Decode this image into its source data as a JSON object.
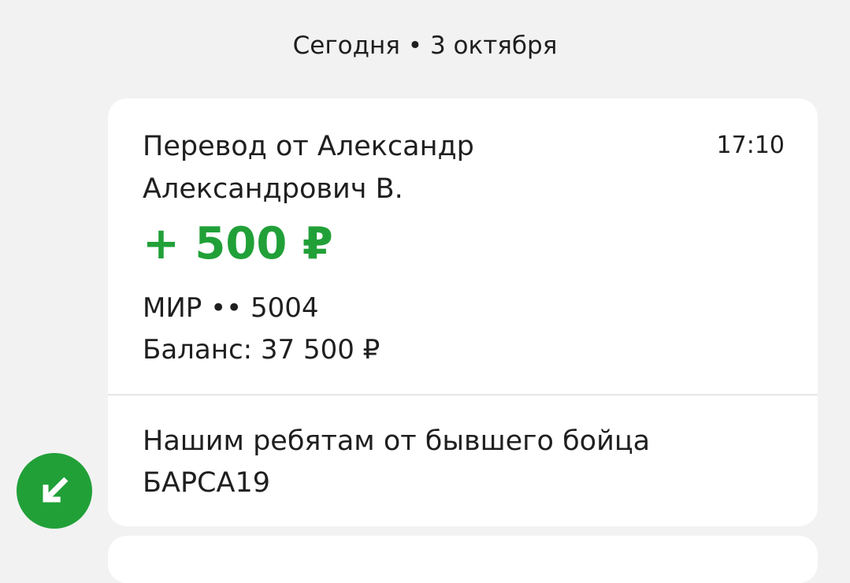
{
  "date_header": "Сегодня • 3 октября",
  "transaction": {
    "title": "Перевод от Александр Александрович В.",
    "time": "17:10",
    "amount": "+ 500 ₽",
    "card": "МИР •• 5004",
    "balance": "Баланс: 37 500 ₽",
    "message": "Нашим ребятам от бывшего бойца БАРСА19"
  },
  "colors": {
    "accent_green": "#21a038",
    "background": "#f2f2f2",
    "card": "#ffffff"
  },
  "icons": {
    "incoming": "arrow-down-left-icon"
  }
}
